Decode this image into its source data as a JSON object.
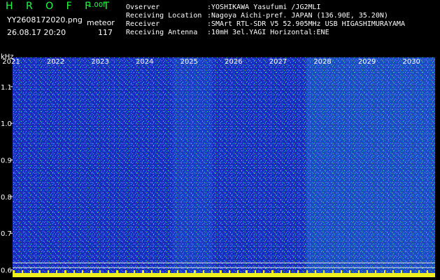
{
  "header": {
    "brand": "H R O F F T",
    "version": "1.00f",
    "filename": "YY2608172020.png",
    "mode": "meteor",
    "datetime": "26.08.17 20:20",
    "count": "117",
    "info": [
      {
        "key": "Ovserver",
        "value": ":YOSHIKAWA Yasufumi /JG2MLI"
      },
      {
        "key": "Receiving Location",
        "value": ":Nagoya Aichi-pref. JAPAN (136.90E, 35.20N)"
      },
      {
        "key": "Receiver",
        "value": ":SMArt RTL-SDR V5 52.905MHz USB HIGASHIMURAYAMA"
      },
      {
        "key": "Receiving Antenna",
        "value": ":10mH 3el.YAGI Horizontal:ENE"
      }
    ]
  },
  "chart_data": {
    "type": "heatmap",
    "title": "",
    "xlabel": "",
    "ylabel": "kHz",
    "x_tick_labels": [
      "2021",
      "2022",
      "2023",
      "2024",
      "2025",
      "2026",
      "2027",
      "2028",
      "2029",
      "2030"
    ],
    "y_ticks": [
      1.1,
      1.0,
      0.9,
      0.8,
      0.7,
      0.6
    ],
    "y_tick_labels": [
      "1.1",
      "1.0",
      "0.9",
      "0.8",
      "0.7",
      "0.6"
    ],
    "ylim": [
      0.58,
      1.18
    ],
    "xlim": [
      2020.8,
      2030.3
    ],
    "colormap": [
      "#0a1aa0",
      "#1f4fd8",
      "#20b0d0",
      "#40f0a0",
      "#f0f020"
    ],
    "background_color": "#1a2fc0",
    "brighter_region_x": [
      2027.4,
      2030.3
    ],
    "vertical_streak_x": [
      2024.4,
      2025.3
    ],
    "level_bar_color": "#f0f020"
  }
}
